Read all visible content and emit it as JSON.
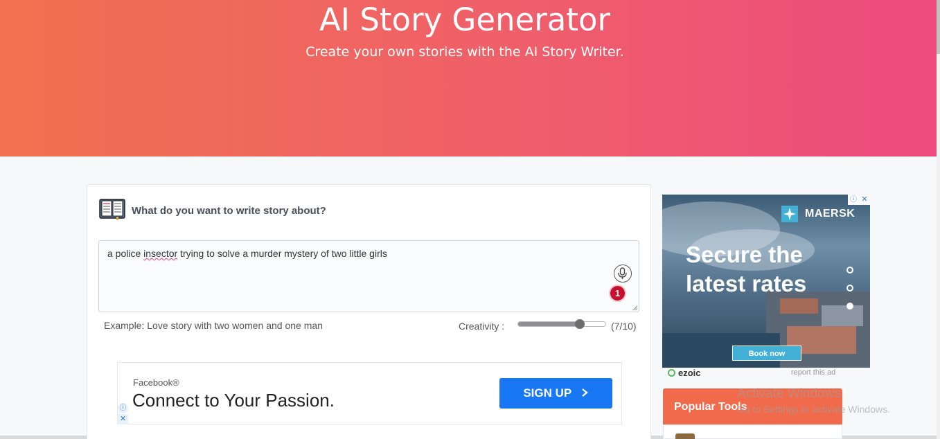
{
  "hero": {
    "title": "AI Story Generator",
    "subtitle": "Create your own stories with the AI Story Writer."
  },
  "form": {
    "icon": "book-icon",
    "question": "What do you want to write story about?",
    "story_prefix": "a police ",
    "story_misspelled": "insector",
    "story_suffix": " trying to solve a murder mystery of two little girls",
    "mic_icon": "microphone-icon",
    "badge_count": "1",
    "example": "Example: Love story with two women and one man",
    "creativity_label": "Creativity :",
    "creativity_value": "(7/10)",
    "creativity_level": 0.7
  },
  "fb_ad": {
    "brand": "Facebook®",
    "headline": "Connect to Your Passion.",
    "button": "SIGN UP",
    "button_icon": "chevron-right-icon",
    "info_icon": "ⓘ",
    "close_icon": "✕",
    "accent": "#1877f2"
  },
  "side_ad": {
    "brand": "MAERSK",
    "headline": "Secure the latest rates",
    "button": "Book now",
    "adchoice_icon": "ⓘ",
    "close_icon": "✕",
    "accent": "#42b0d5",
    "slides": 3,
    "active_slide": 3
  },
  "ezoic": {
    "brand": "ezoic",
    "report": "report this ad"
  },
  "popular": {
    "label": "Popular Tools",
    "accent": "#f06a4b"
  },
  "watermark": {
    "title": "Activate Windows",
    "subtitle": "Go to Settings to activate Windows."
  },
  "theme": {
    "hero_gradient_start": "#f2704f",
    "hero_gradient_end": "#ee4a7e"
  }
}
